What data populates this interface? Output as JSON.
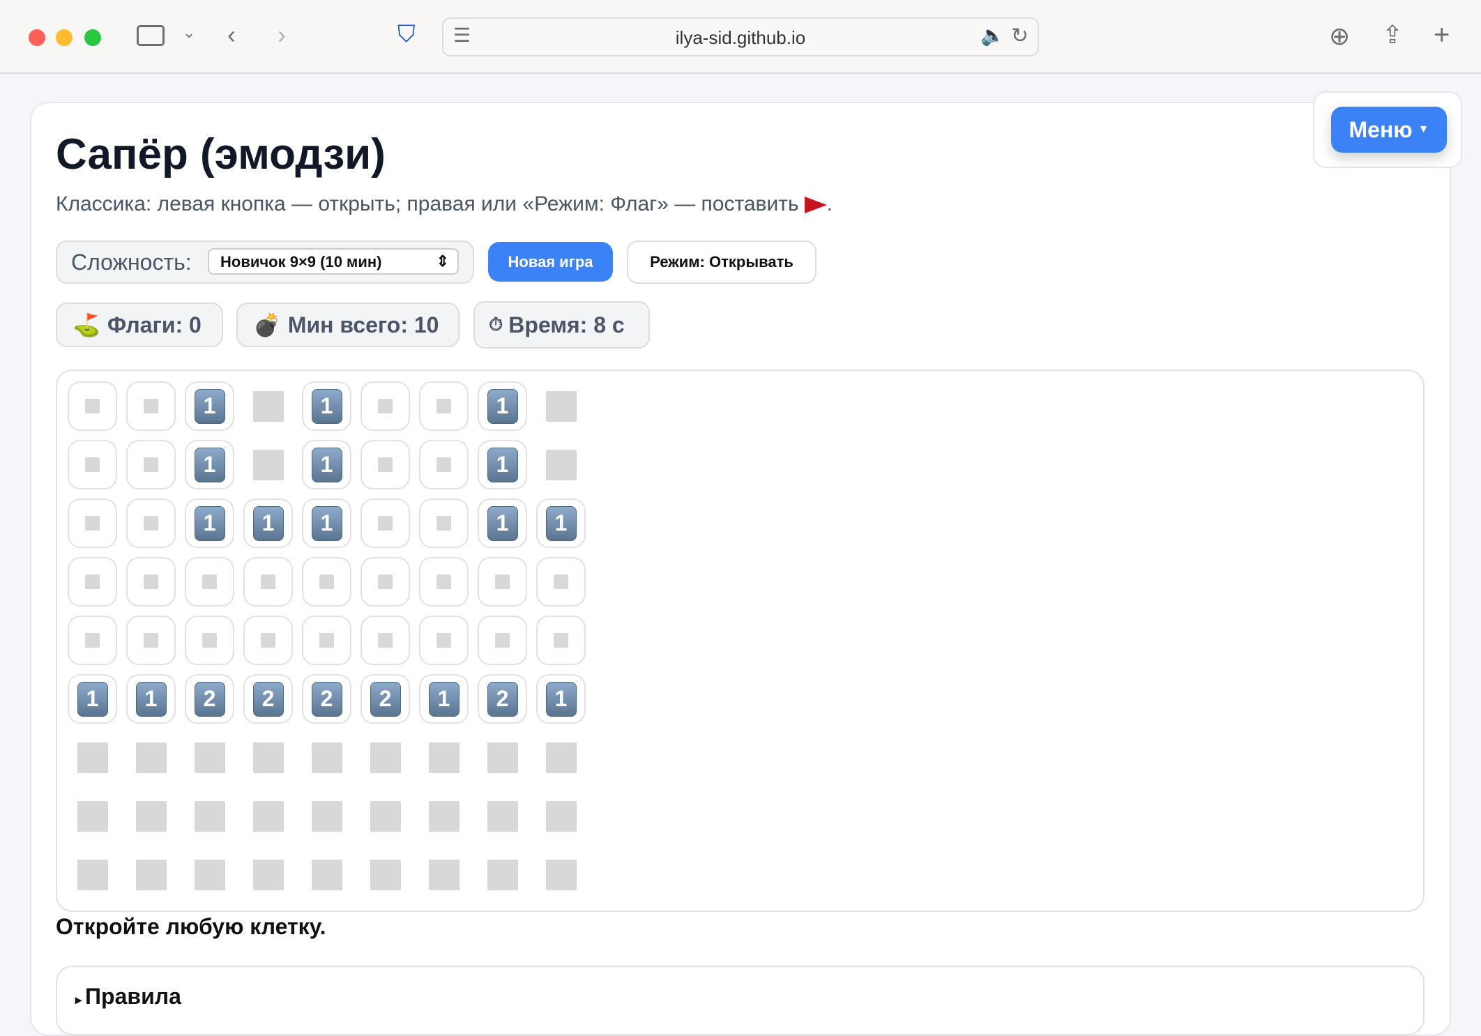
{
  "browser": {
    "url": "ilya-sid.github.io"
  },
  "page": {
    "title": "Сапёр (эмодзи)",
    "subtitle": "Классика: левая кнопка — открыть; правая или «Режим: Флаг» — поставить",
    "subtitle_end": ".",
    "difficulty_label": "Сложность:",
    "difficulty_value": "Новичок 9×9 (10 мин)",
    "new_game": "Новая игра",
    "mode": "Режим: Открывать",
    "flags": "Флаги: 0",
    "mines": "Мин всего: 10",
    "time": "Время: 8 с",
    "status": "Откройте любую клетку.",
    "rules": "Правила",
    "menu": "Меню"
  },
  "board": [
    [
      "o",
      "o",
      "1",
      "u",
      "1",
      "o",
      "o",
      "1",
      "u"
    ],
    [
      "o",
      "o",
      "1",
      "u",
      "1",
      "o",
      "o",
      "1",
      "u"
    ],
    [
      "o",
      "o",
      "1",
      "1",
      "1",
      "o",
      "o",
      "1",
      "1"
    ],
    [
      "o",
      "o",
      "o",
      "o",
      "o",
      "o",
      "o",
      "o",
      "o"
    ],
    [
      "o",
      "o",
      "o",
      "o",
      "o",
      "o",
      "o",
      "o",
      "o"
    ],
    [
      "1",
      "1",
      "2",
      "2",
      "2",
      "2",
      "1",
      "2",
      "1"
    ],
    [
      "u",
      "u",
      "u",
      "u",
      "u",
      "u",
      "u",
      "u",
      "u"
    ],
    [
      "u",
      "u",
      "u",
      "u",
      "u",
      "u",
      "u",
      "u",
      "u"
    ],
    [
      "u",
      "u",
      "u",
      "u",
      "u",
      "u",
      "u",
      "u",
      "u"
    ]
  ],
  "colors": {
    "accent": "#3b82f6",
    "number_tile": "#6c88a6",
    "hidden": "#d8d8d8"
  }
}
